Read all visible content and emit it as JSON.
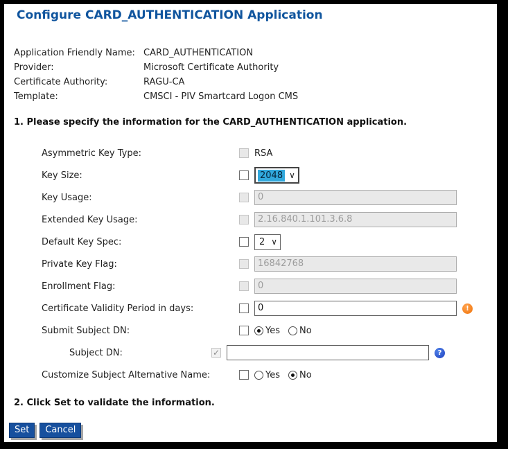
{
  "page": {
    "title": "Configure CARD_AUTHENTICATION Application"
  },
  "info": {
    "rows": [
      {
        "label": "Application Friendly Name:",
        "value": "CARD_AUTHENTICATION"
      },
      {
        "label": "Provider:",
        "value": "Microsoft Certificate Authority"
      },
      {
        "label": "Certificate Authority:",
        "value": "RAGU-CA"
      },
      {
        "label": "Template:",
        "value": "CMSCI - PIV Smartcard Logon CMS"
      }
    ]
  },
  "sections": {
    "step1": "1. Please specify the information for the CARD_AUTHENTICATION application.",
    "step2": "2. Click Set to validate the information."
  },
  "form": {
    "rows": [
      {
        "label": "Asymmetric Key Type:",
        "value": "RSA"
      },
      {
        "label": "Key Size:",
        "value": "2048"
      },
      {
        "label": "Key Usage:",
        "value": "0"
      },
      {
        "label": "Extended Key Usage:",
        "value": "2.16.840.1.101.3.6.8"
      },
      {
        "label": "Default Key Spec:",
        "value": "2"
      },
      {
        "label": "Private Key Flag:",
        "value": "16842768"
      },
      {
        "label": "Enrollment Flag:",
        "value": "0"
      },
      {
        "label": "Certificate Validity Period in days:",
        "value": "0"
      },
      {
        "label": "Submit Subject DN:",
        "yes": "Yes",
        "no": "No",
        "selected": "Yes"
      },
      {
        "label": "Subject DN:",
        "value": ""
      },
      {
        "label": "Customize Subject Alternative Name:",
        "yes": "Yes",
        "no": "No",
        "selected": "No"
      }
    ],
    "chevron": "∨",
    "checkmark": "✓"
  },
  "icons": {
    "warning": "!",
    "help": "?"
  },
  "buttons": {
    "set": "Set",
    "cancel": "Cancel"
  },
  "colors": {
    "title": "#10559e",
    "button": "#17509e",
    "select_highlight": "#31a8dc",
    "warning": "#f0730a",
    "help": "#1e3fbf"
  }
}
